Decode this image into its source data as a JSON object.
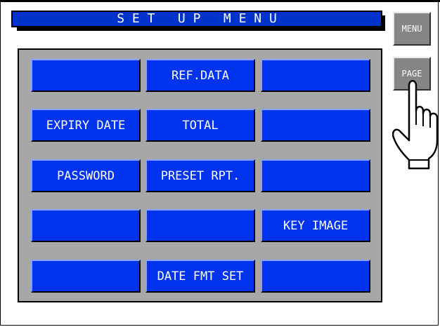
{
  "title": "S E T   U P   M E N U",
  "side_buttons": {
    "menu_label": "MENU",
    "page_label": "PAGE"
  },
  "keys": [
    "",
    "REF.DATA",
    "",
    "EXPIRY DATE",
    "TOTAL",
    "",
    "PASSWORD",
    "PRESET RPT.",
    "",
    "",
    "",
    "KEY IMAGE",
    "",
    "DATE FMT SET",
    ""
  ],
  "colors": {
    "title_bar": "#0033cc",
    "key": "#0033ee",
    "panel": "#a7a7a7",
    "side_button": "#858585"
  },
  "icons": {
    "pointer": "pointing-hand-icon"
  }
}
